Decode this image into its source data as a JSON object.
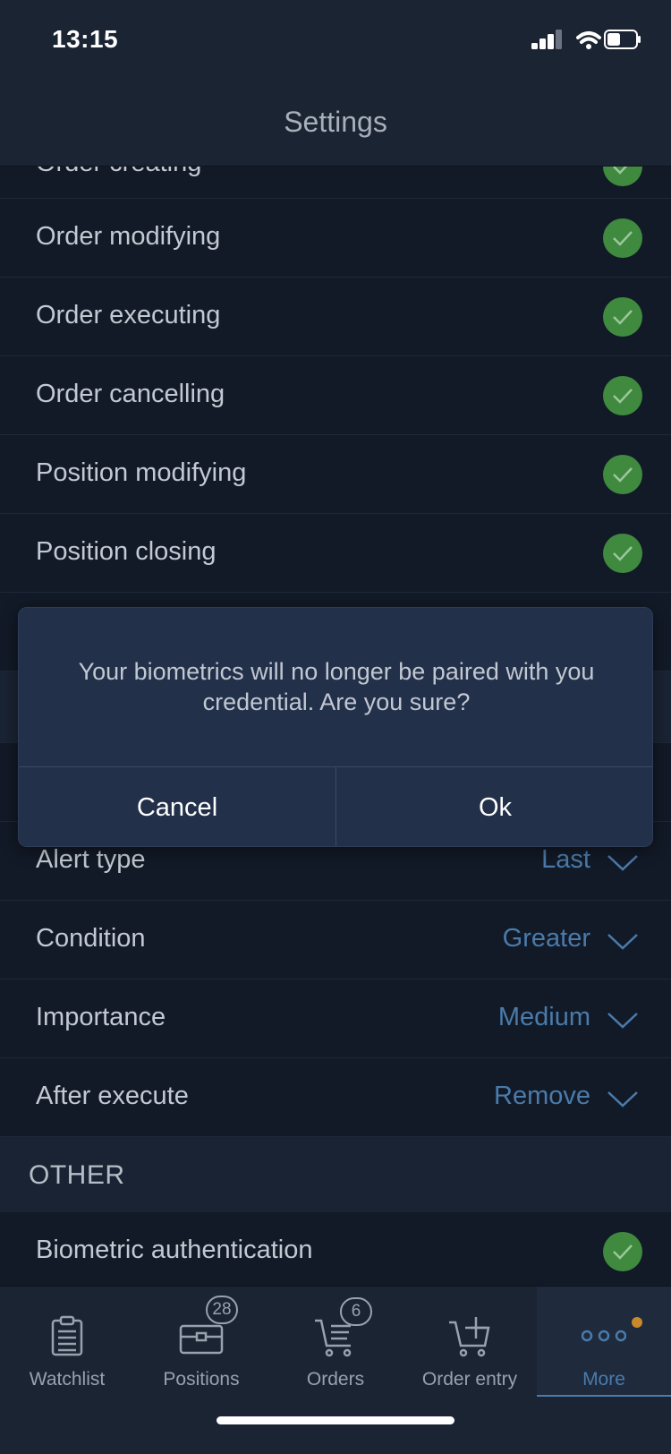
{
  "status_bar": {
    "time": "13:15"
  },
  "header": {
    "title": "Settings"
  },
  "notifications": {
    "items": [
      {
        "label": "Order creating",
        "enabled": true
      },
      {
        "label": "Order modifying",
        "enabled": true
      },
      {
        "label": "Order executing",
        "enabled": true
      },
      {
        "label": "Order cancelling",
        "enabled": true
      },
      {
        "label": "Position modifying",
        "enabled": true
      },
      {
        "label": "Position closing",
        "enabled": true
      }
    ]
  },
  "alerts": {
    "items": [
      {
        "label": "Alert type",
        "value": "Last"
      },
      {
        "label": "Condition",
        "value": "Greater"
      },
      {
        "label": "Importance",
        "value": "Medium"
      },
      {
        "label": "After execute",
        "value": "Remove"
      }
    ]
  },
  "other": {
    "title": "OTHER",
    "items": [
      {
        "label": "Biometric authentication",
        "enabled": true
      }
    ]
  },
  "dialog": {
    "message": "Your biometrics will no longer be paired with you credential. Are you sure?",
    "cancel_label": "Cancel",
    "ok_label": "Ok"
  },
  "tab_bar": {
    "tabs": [
      {
        "label": "Watchlist",
        "icon": "clipboard-icon"
      },
      {
        "label": "Positions",
        "icon": "briefcase-icon",
        "badge": "28"
      },
      {
        "label": "Orders",
        "icon": "cart-list-icon",
        "badge": "6"
      },
      {
        "label": "Order entry",
        "icon": "cart-plus-icon"
      },
      {
        "label": "More",
        "icon": "more-dots-icon",
        "active": true,
        "notification_dot": true
      }
    ]
  },
  "colors": {
    "accent": "#4a7bab",
    "check_green": "#3f8a3f",
    "dot_orange": "#c8892a"
  }
}
